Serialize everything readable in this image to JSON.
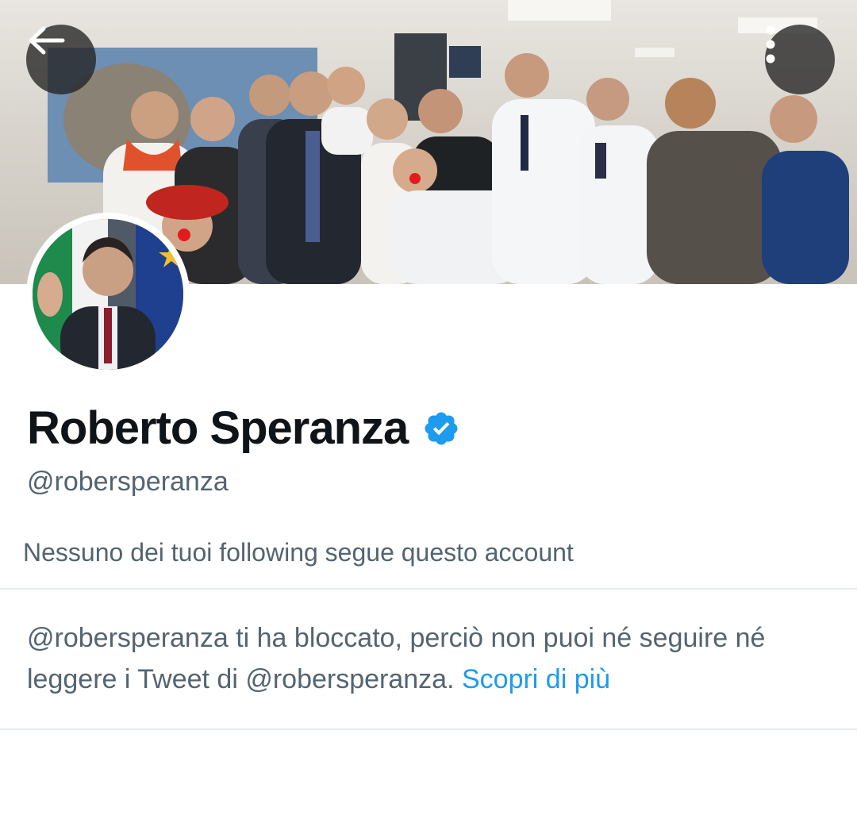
{
  "header": {
    "back_icon": "arrow-left-icon",
    "more_icon": "vertical-dots-icon"
  },
  "profile": {
    "display_name": "Roberto Speranza",
    "verified_icon": "verified-badge-icon",
    "verified_color": "#1d9bf0",
    "handle": "@robersperanza",
    "followers_you_know": "Nessuno dei tuoi following segue questo account"
  },
  "blocked_notice": {
    "message": "@robersperanza ti ha bloccato, perciò non puoi né seguire né leggere i Tweet di @robersperanza.",
    "link_label": "Scopri di più"
  },
  "colors": {
    "primary_text": "#0f1419",
    "secondary_text": "#536471",
    "accent": "#1d9bf0",
    "divider": "#e6ecf0"
  }
}
